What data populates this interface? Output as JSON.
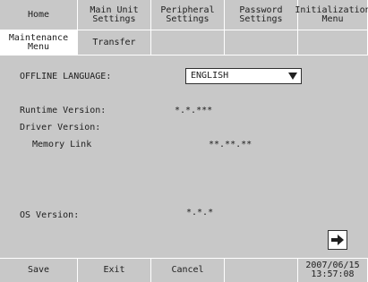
{
  "tabs_row1": [
    {
      "label": "Home"
    },
    {
      "label": "Main Unit\nSettings"
    },
    {
      "label": "Peripheral\nSettings"
    },
    {
      "label": "Password\nSettings"
    },
    {
      "label": "Initialization\nMenu"
    }
  ],
  "tabs_row2": [
    {
      "label": "Maintenance\nMenu"
    },
    {
      "label": "Transfer"
    }
  ],
  "settings": {
    "offline_language_label": "OFFLINE LANGUAGE:",
    "offline_language_value": "ENGLISH",
    "runtime_version_label": "Runtime Version:",
    "runtime_version_value": "*.*.***",
    "driver_version_label": "Driver Version:",
    "memory_link_label": "Memory Link",
    "memory_link_value": "**.**.**",
    "os_version_label": "OS Version:",
    "os_version_value": "*.*.*"
  },
  "footer": {
    "save_label": "Save",
    "exit_label": "Exit",
    "cancel_label": "Cancel",
    "datetime": "2007/06/15\n13:57:08"
  },
  "icons": {
    "dropdown": "triangle-down-icon",
    "next": "arrow-right-icon"
  }
}
